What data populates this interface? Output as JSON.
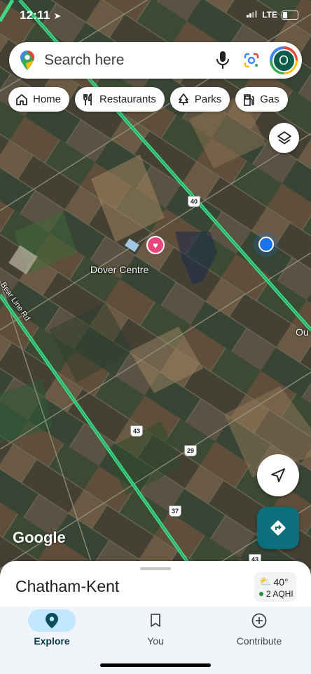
{
  "status_bar": {
    "time": "12:11",
    "network": "LTE"
  },
  "search": {
    "placeholder": "Search here",
    "avatar_initial": "O"
  },
  "chips": [
    {
      "label": "Home",
      "icon": "home-icon"
    },
    {
      "label": "Restaurants",
      "icon": "fork-knife-icon"
    },
    {
      "label": "Parks",
      "icon": "tree-icon"
    },
    {
      "label": "Gas",
      "icon": "gas-pump-icon"
    }
  ],
  "map": {
    "place_label": "Dover Centre",
    "road_label": "Bear Line Rd",
    "edge_label": "Ou",
    "route_shields": [
      "40",
      "43",
      "29",
      "37",
      "43"
    ],
    "attribution": "Google"
  },
  "sheet": {
    "place_name": "Chatham-Kent",
    "temperature": "40°",
    "aqi": "2 AQHI"
  },
  "nav": {
    "explore": "Explore",
    "you": "You",
    "contribute": "Contribute"
  },
  "colors": {
    "highway": "#3ee08a",
    "accent_teal": "#0b6f7c",
    "location_dot": "#1a73e8",
    "saved_heart": "#e8457c",
    "nav_active": "#c2e7ff"
  }
}
